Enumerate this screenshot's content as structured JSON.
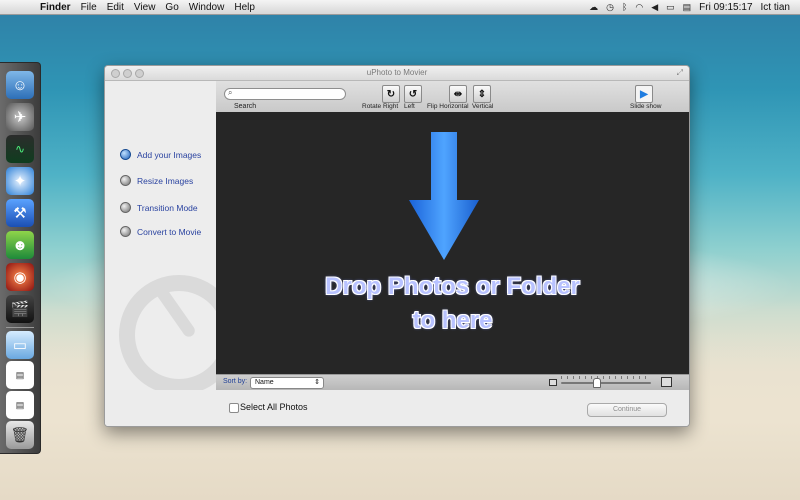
{
  "menubar": {
    "apple_glyph": "",
    "app": "Finder",
    "menus": [
      "File",
      "Edit",
      "View",
      "Go",
      "Window",
      "Help"
    ],
    "status_icons": [
      "cloud-icon",
      "time-machine-icon",
      "bluetooth-icon",
      "wifi-icon",
      "volume-icon",
      "battery-icon",
      "flag-icon"
    ],
    "clock": "Fri 09:15:17",
    "user": "Ict tian"
  },
  "window": {
    "title": "uPhoto to Movier",
    "steps": [
      {
        "label": "Add your Images",
        "active": true
      },
      {
        "label": "Resize Images",
        "active": false
      },
      {
        "label": "Transition Mode",
        "active": false
      },
      {
        "label": "Convert to Movie",
        "active": false
      }
    ],
    "toolbar": {
      "search_placeholder": "",
      "search_label": "Search",
      "rotate_right": "Rotate Right",
      "rotate_left": "Left",
      "flip_horizontal": "Flip Horizontal",
      "flip_vertical": "Vertical",
      "slide_show": "Slide show"
    },
    "drop_zone": {
      "line1": "Drop Photos or Folder",
      "line2": "to  here"
    },
    "sortbar": {
      "label": "Sort by:",
      "value": "Name"
    },
    "footer": {
      "select_all": "Select All Photos",
      "continue": "Continue"
    }
  },
  "colors": {
    "accent_blue": "#1f7ce0",
    "step_text": "#2a43a0",
    "canvas_bg": "#262626",
    "drop_text": "#b8c2ff"
  }
}
